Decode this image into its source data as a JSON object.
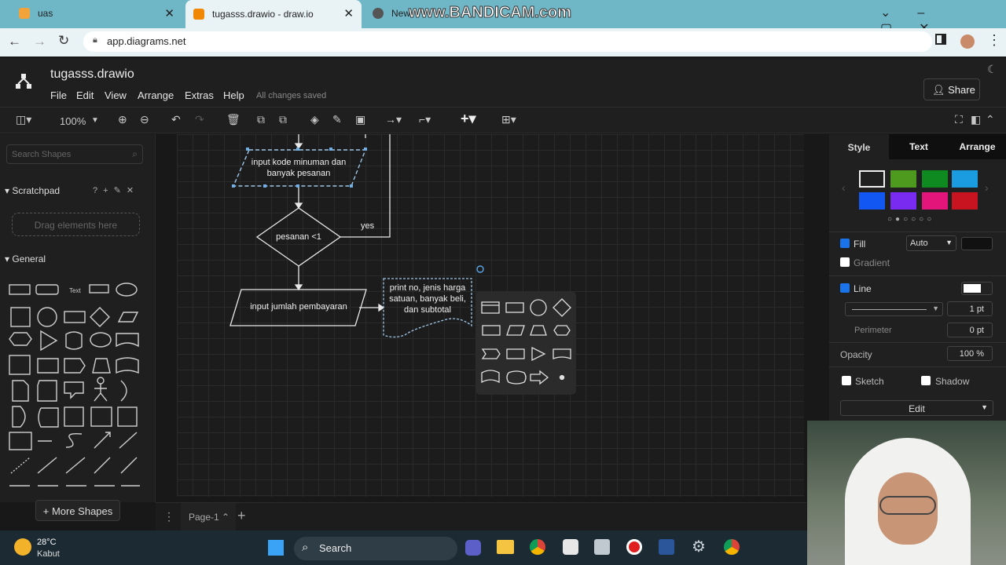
{
  "browser": {
    "tabs": [
      {
        "label": "uas"
      },
      {
        "label": "tugasss.drawio - draw.io"
      },
      {
        "label": "New"
      }
    ],
    "watermark": "www.BANDICAM.com",
    "url": "app.diagrams.net"
  },
  "app": {
    "filename": "tugasss.drawio",
    "menu": [
      "File",
      "Edit",
      "View",
      "Arrange",
      "Extras",
      "Help"
    ],
    "save_status": "All changes saved",
    "share_label": "Share",
    "zoom": "100%"
  },
  "left_panel": {
    "search_placeholder": "Search Shapes",
    "scratchpad_title": "Scratchpad",
    "scratchpad_tools": "? + ✎ ✕",
    "drag_hint": "Drag elements here",
    "general_title": "General",
    "more_shapes": "+ More Shapes"
  },
  "diagram": {
    "input_code": "input kode minuman dan banyak pesanan",
    "decision": "pesanan <1",
    "yes_label": "yes",
    "input_payment": "input jumlah pembayaran",
    "print_doc": "print no, jenis harga satuan, banyak beli, dan subtotal"
  },
  "right_panel": {
    "tabs": [
      "Style",
      "Text",
      "Arrange"
    ],
    "swatches": [
      "#1a1a1a",
      "#4e9a1f",
      "#0f8a21",
      "#1b9be0",
      "#1257f2",
      "#7a2bf2",
      "#e3157a",
      "#c81421"
    ],
    "fill_label": "Fill",
    "fill_mode": "Auto",
    "gradient_label": "Gradient",
    "line_label": "Line",
    "line_width": "1 pt",
    "perimeter_label": "Perimeter",
    "perimeter_value": "0 pt",
    "opacity_label": "Opacity",
    "opacity_value": "100 %",
    "sketch_label": "Sketch",
    "shadow_label": "Shadow",
    "edit_label": "Edit"
  },
  "bottom": {
    "page_label": "Page-1"
  },
  "taskbar": {
    "temp": "28°C",
    "weather": "Kabut",
    "search": "Search"
  }
}
